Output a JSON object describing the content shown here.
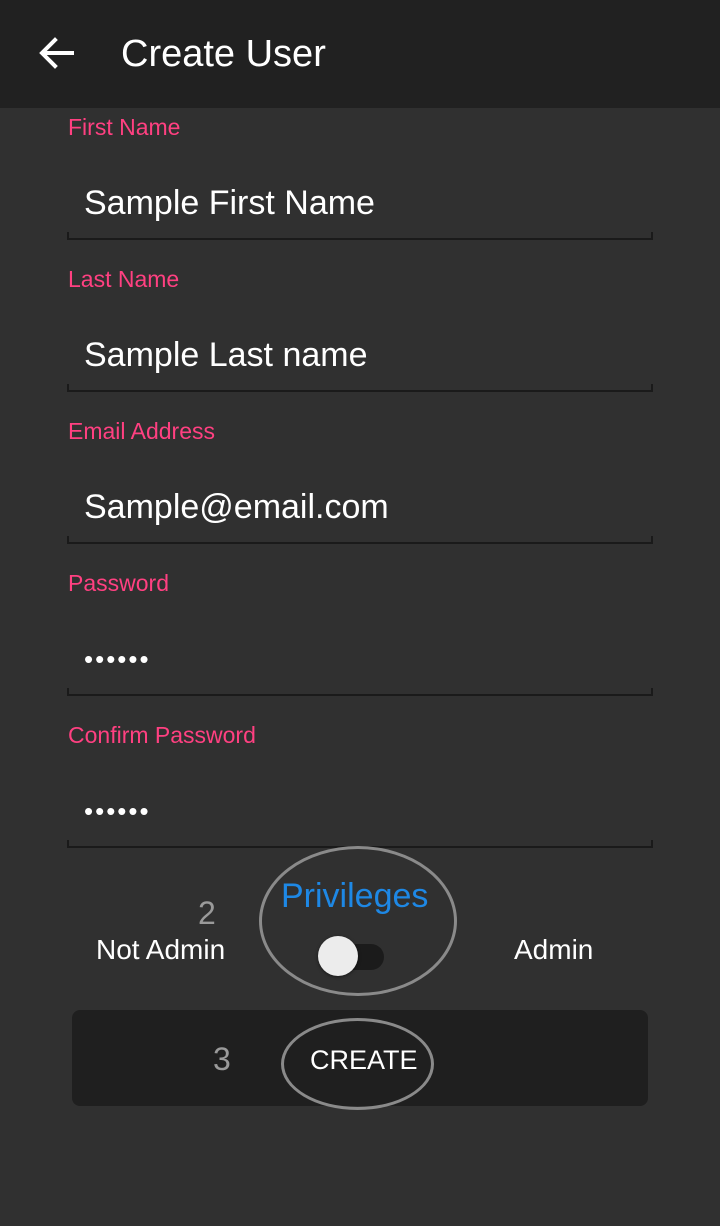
{
  "app_bar": {
    "title": "Create User",
    "back_icon": "arrow-left-icon"
  },
  "form": {
    "first_name": {
      "label": "First Name",
      "value": "Sample First Name"
    },
    "last_name": {
      "label": "Last Name",
      "value": "Sample Last name"
    },
    "email": {
      "label": "Email Address",
      "value": "Sample@email.com"
    },
    "password": {
      "label": "Password",
      "value": "••••••"
    },
    "confirm_password": {
      "label": "Confirm Password",
      "value": "••••••"
    }
  },
  "privileges": {
    "title": "Privileges",
    "off_label": "Not Admin",
    "on_label": "Admin",
    "is_admin": false
  },
  "create_button": {
    "label": "CREATE"
  },
  "annotations": {
    "marker_2": "2",
    "marker_3": "3"
  },
  "colors": {
    "background": "#303030",
    "app_bar": "#212121",
    "label_accent": "#ff4081",
    "privileges_title": "#1e88e5",
    "button": "#1f1f1f"
  }
}
